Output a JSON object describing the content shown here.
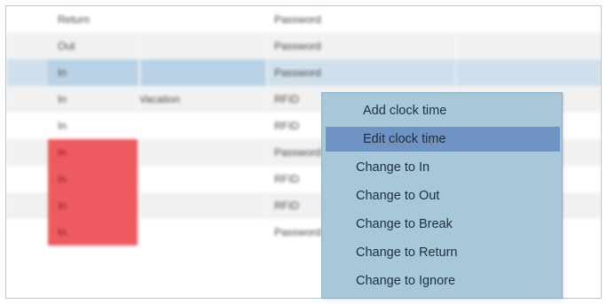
{
  "table": {
    "rows": [
      {
        "type": "Return",
        "note": "",
        "method": "Password",
        "style": "plain"
      },
      {
        "type": "Out",
        "note": "",
        "method": "Password",
        "style": "alt"
      },
      {
        "type": "In",
        "note": "",
        "method": "Password",
        "style": "selected"
      },
      {
        "type": "In",
        "note": "Vacation",
        "method": "RFID",
        "style": "alt"
      },
      {
        "type": "In",
        "note": "",
        "method": "RFID",
        "style": "plain"
      },
      {
        "type": "In",
        "note": "",
        "method": "Password",
        "style": "alt",
        "flag": "red"
      },
      {
        "type": "In",
        "note": "",
        "method": "RFID",
        "style": "plain",
        "flag": "red"
      },
      {
        "type": "In",
        "note": "",
        "method": "RFID",
        "style": "alt",
        "flag": "red"
      },
      {
        "type": "In",
        "note": "",
        "method": "Password",
        "style": "plain",
        "flag": "red"
      }
    ],
    "flag_color": "#ee5a5f",
    "selected_color": "#cfe0ec"
  },
  "context_menu": {
    "items": [
      {
        "label": "Add clock time",
        "highlighted": false
      },
      {
        "label": "Edit  clock time",
        "highlighted": true
      },
      {
        "label": "Change to In",
        "highlighted": false
      },
      {
        "label": "Change to Out",
        "highlighted": false
      },
      {
        "label": "Change to Break",
        "highlighted": false
      },
      {
        "label": "Change to Return",
        "highlighted": false
      },
      {
        "label": "Change to Ignore",
        "highlighted": false
      }
    ],
    "background": "#a8c7d9",
    "highlight_color": "#6f93c2"
  }
}
